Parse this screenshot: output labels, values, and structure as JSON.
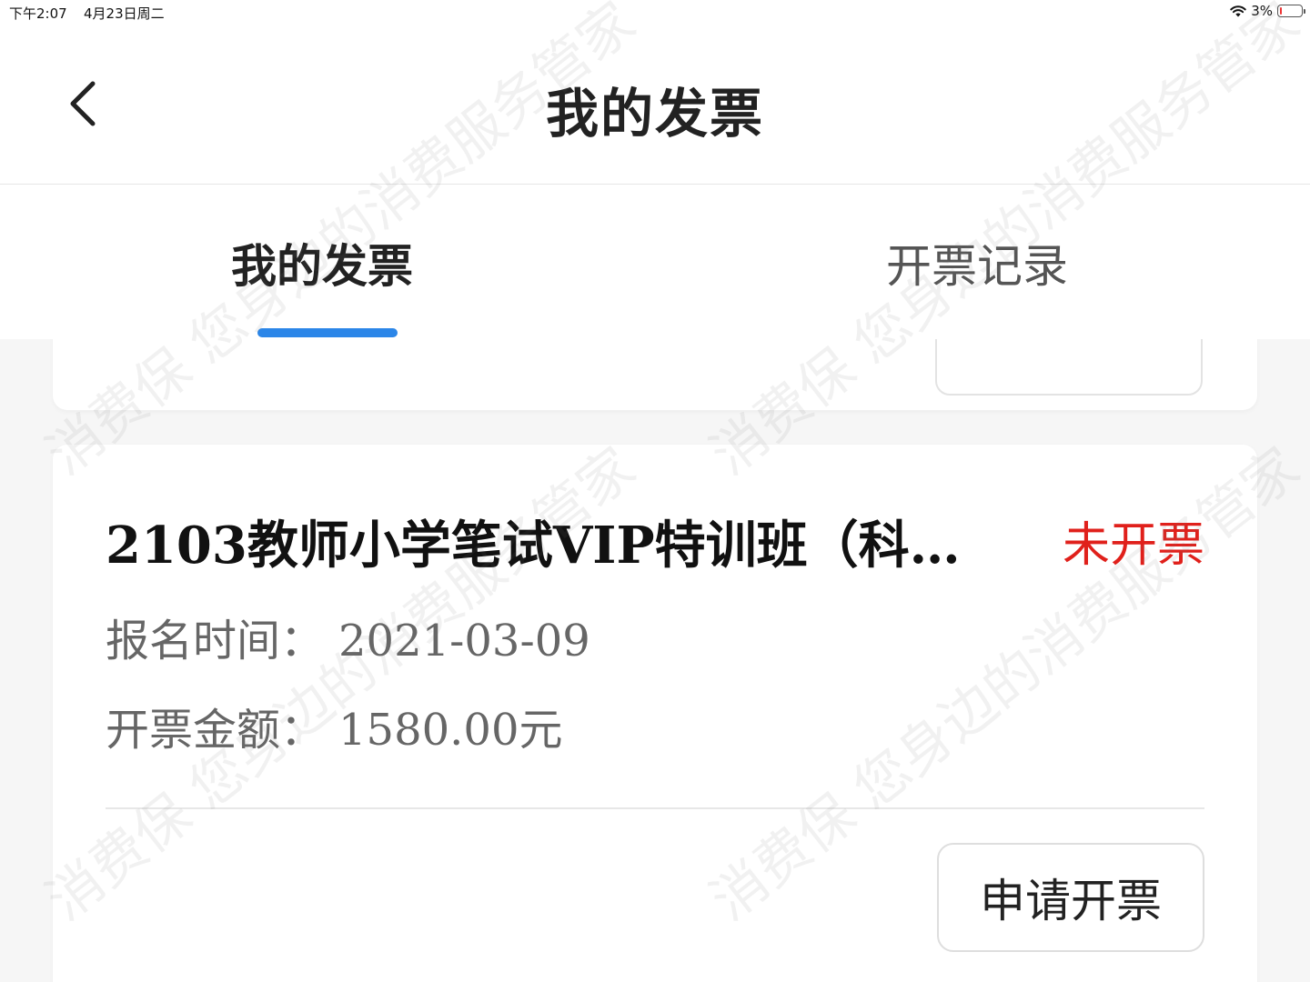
{
  "status_bar": {
    "time": "下午2:07",
    "date": "4月23日周二",
    "battery": "3%"
  },
  "nav": {
    "title": "我的发票",
    "back_icon": "chevron-left-icon"
  },
  "tabs": [
    {
      "label": "我的发票",
      "active": true
    },
    {
      "label": "开票记录",
      "active": false
    }
  ],
  "colors": {
    "accent": "#2b86e8",
    "status_red": "#e0201b",
    "background": "#f6f6f6"
  },
  "invoice": {
    "title": "2103教师小学笔试VIP特训班（科…",
    "status": "未开票",
    "date_label": "报名时间：",
    "date_value": "2021-03-09",
    "amount_label": "开票金额：",
    "amount_value": "1580.00元",
    "apply_button": "申请开票"
  },
  "watermark": "消费保 您身边的消费服务管家"
}
